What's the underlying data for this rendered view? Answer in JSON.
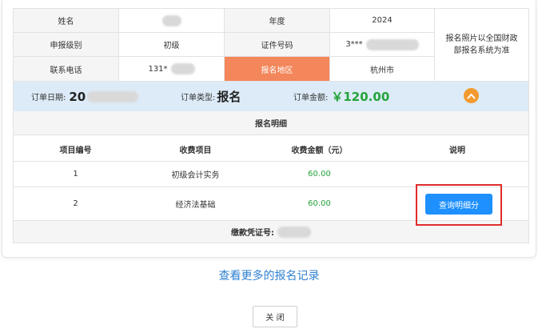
{
  "info": {
    "name_label": "姓名",
    "year_label": "年度",
    "year_value": "2024",
    "level_label": "申报级别",
    "level_value": "初级",
    "id_label": "证件号码",
    "id_value": "3***",
    "phone_label": "联系电话",
    "phone_value": "131*",
    "region_label": "报名地区",
    "region_value": "杭州市",
    "photo_note": "报名照片以全国财政部报名系统为准"
  },
  "order": {
    "date_label": "订单日期:",
    "date_value": "20",
    "type_label": "订单类型:",
    "type_value": "报名",
    "amount_label": "订单金额:",
    "amount_value": "￥120.00"
  },
  "detail": {
    "title": "报名明细",
    "headers": [
      "项目编号",
      "收费项目",
      "收费金额（元）",
      "说明"
    ],
    "rows": [
      {
        "no": "1",
        "item": "初级会计实务",
        "amount": "60.00"
      },
      {
        "no": "2",
        "item": "经济法基础",
        "amount": "60.00"
      }
    ],
    "query_button": "查询明细分",
    "voucher_label": "缴款凭证号:"
  },
  "more_link": "查看更多的报名记录",
  "close_button": "关 闭",
  "colors": {
    "accent_orange": "#f3865a",
    "order_bar": "#dcebf7",
    "amount_green": "#24a33a",
    "button_blue": "#1e90ff",
    "highlight_red": "#e02b2b"
  }
}
